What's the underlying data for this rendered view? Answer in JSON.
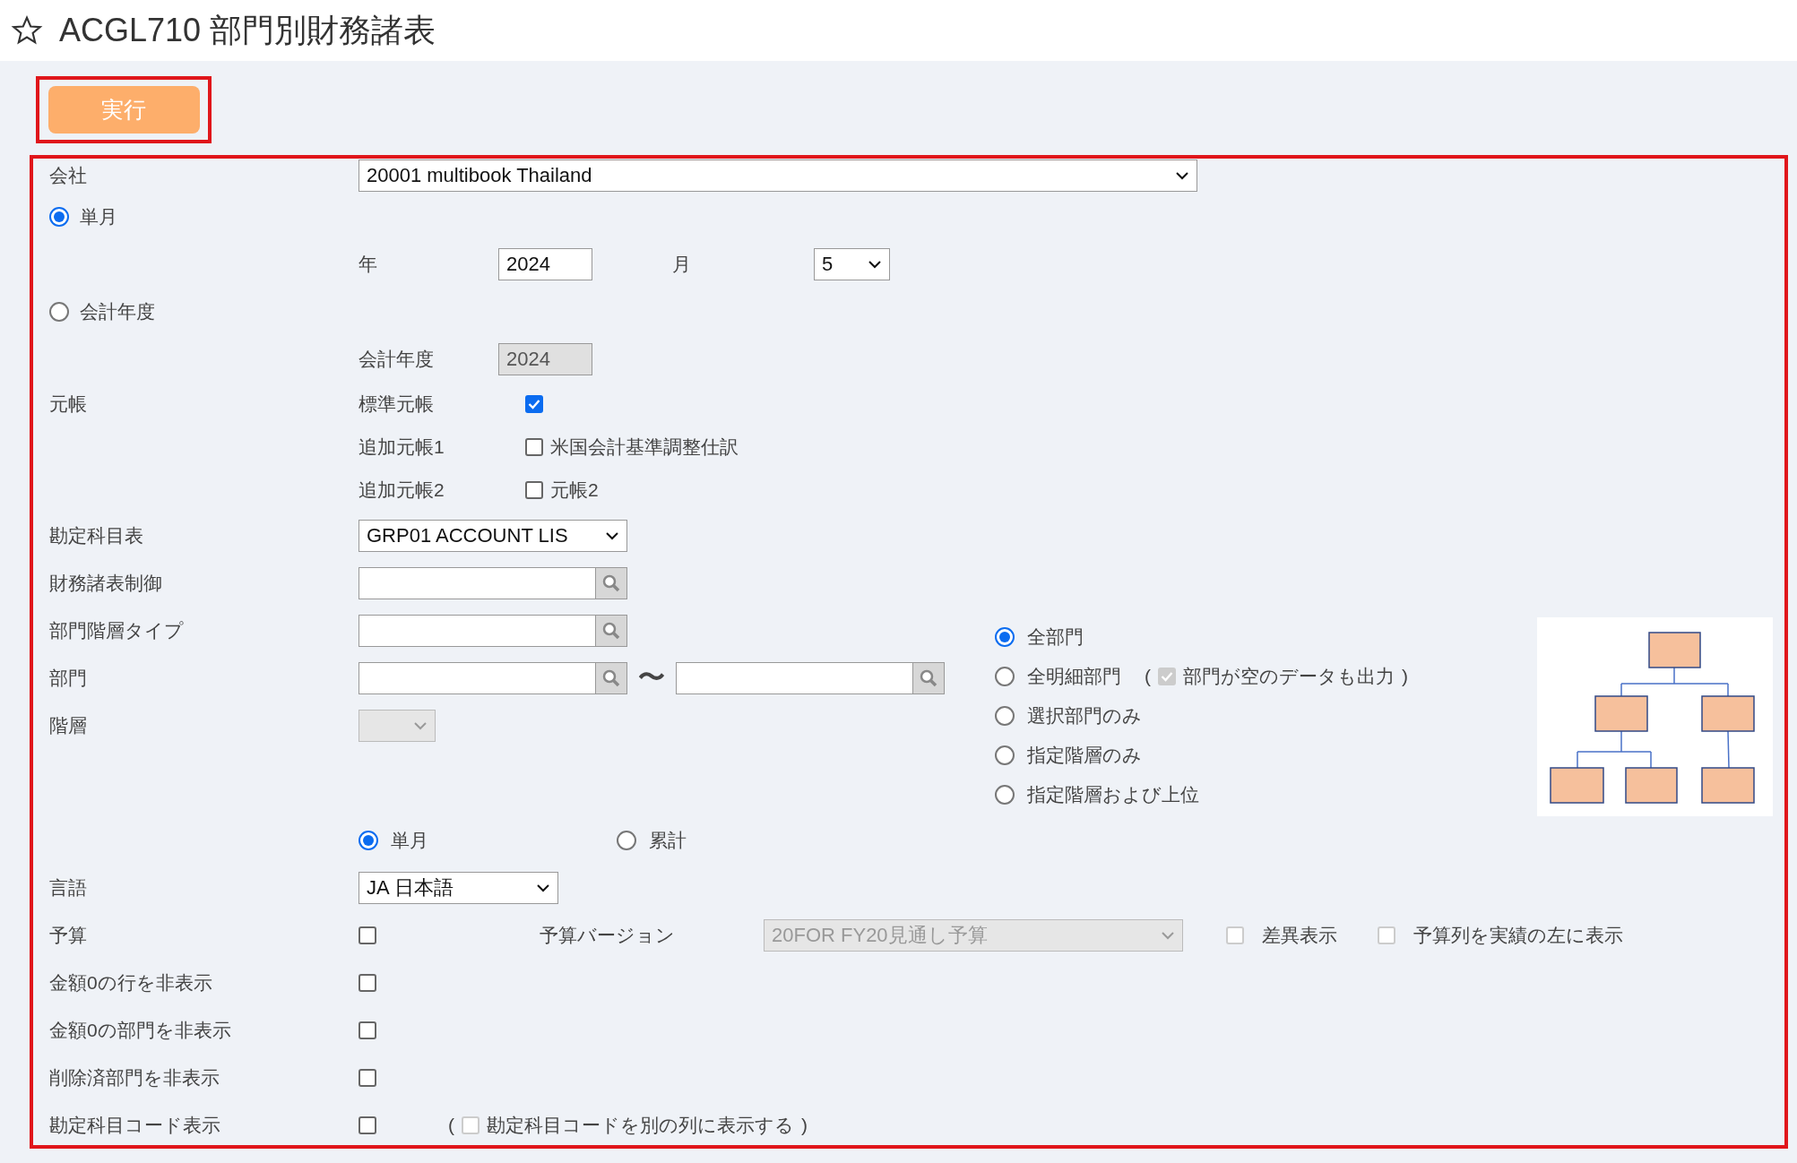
{
  "header": {
    "title": "ACGL710 部門別財務諸表",
    "favorite": false
  },
  "run_button": {
    "label": "実行",
    "highlighted": true
  },
  "form": {
    "highlighted": true,
    "company": {
      "label": "会社",
      "value": "20001 multibook Thailand"
    },
    "period_mode": [
      {
        "label": "単月",
        "selected": true
      },
      {
        "label": "会計年度",
        "selected": false
      }
    ],
    "year_month": {
      "year_label": "年",
      "year": "2024",
      "month_label": "月",
      "month": "5"
    },
    "fiscal_year": {
      "label": "会計年度",
      "value": "2024",
      "disabled": true
    },
    "ledger": {
      "label": "元帳",
      "items": [
        {
          "label": "標準元帳",
          "checked": true
        },
        {
          "label": "追加元帳1",
          "option": "米国会計基準調整仕訳",
          "checked": false
        },
        {
          "label": "追加元帳2",
          "option": "元帳2",
          "checked": false
        }
      ]
    },
    "account_chart": {
      "label": "勘定科目表",
      "value": "GRP01 ACCOUNT LIS"
    },
    "fs_control": {
      "label": "財務諸表制御"
    },
    "dept_hierarchy_type": {
      "label": "部門階層タイプ"
    },
    "department": {
      "label": "部門",
      "separator": "〜"
    },
    "hierarchy_level": {
      "label": "階層",
      "disabled": true
    },
    "dept_scope": [
      {
        "label": "全部門",
        "selected": true
      },
      {
        "label": "全明細部門",
        "selected": false,
        "sub": {
          "open": "(",
          "label": "部門が空のデータも出力",
          "close": ")",
          "checked": true,
          "disabled": true
        }
      },
      {
        "label": "選択部門のみ",
        "selected": false
      },
      {
        "label": "指定階層のみ",
        "selected": false
      },
      {
        "label": "指定階層および上位",
        "selected": false
      }
    ],
    "amount_mode": [
      {
        "label": "単月",
        "selected": true
      },
      {
        "label": "累計",
        "selected": false
      }
    ],
    "language": {
      "label": "言語",
      "value": "JA 日本語"
    },
    "budget": {
      "label": "予算",
      "checked": false,
      "version_label": "予算バージョン",
      "version": "20FOR FY20見通し予算",
      "version_disabled": true,
      "options": [
        {
          "label": "差異表示",
          "checked": false,
          "disabled": true
        },
        {
          "label": "予算列を実績の左に表示",
          "checked": false,
          "disabled": true
        }
      ]
    },
    "flags": [
      {
        "label": "金額0の行を非表示",
        "checked": false
      },
      {
        "label": "金額0の部門を非表示",
        "checked": false
      },
      {
        "label": "削除済部門を非表示",
        "checked": false
      },
      {
        "label": "勘定科目コード表示",
        "checked": false,
        "note": {
          "open": "(",
          "label": "勘定科目コードを別の列に表示する",
          "close": ")",
          "checked": false,
          "disabled": true
        }
      }
    ]
  }
}
